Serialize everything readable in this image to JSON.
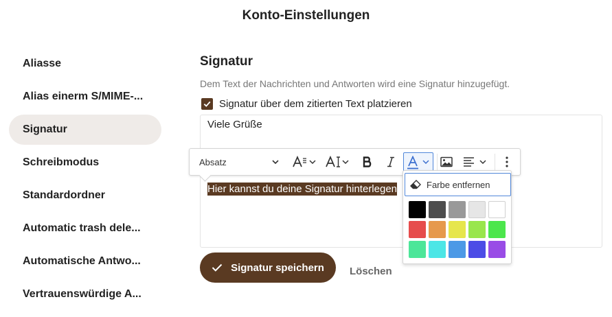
{
  "modal": {
    "title": "Konto-Einstellungen"
  },
  "sidebar": {
    "items": [
      {
        "label": "Aliasse",
        "active": false
      },
      {
        "label": "Alias einerm S/MIME-...",
        "active": false
      },
      {
        "label": "Signatur",
        "active": true
      },
      {
        "label": "Schreibmodus",
        "active": false
      },
      {
        "label": "Standardordner",
        "active": false
      },
      {
        "label": "Automatic trash dele...",
        "active": false
      },
      {
        "label": "Automatische Antwo...",
        "active": false
      },
      {
        "label": "Vertrauenswürdige A...",
        "active": false
      }
    ]
  },
  "signature": {
    "title": "Signatur",
    "description": "Dem Text der Nachrichten und Antworten wird eine Signatur hinzugefügt.",
    "above_quote_label": "Signatur über dem zitierten Text platzieren",
    "above_quote_checked": true,
    "editor_line1": "Viele Grüße",
    "editor_selected_text": "Hier kannst du deine Signatur hinterlegen"
  },
  "toolbar": {
    "heading_value": "Absatz",
    "icons": [
      "font-size-icon",
      "font-family-icon",
      "bold-icon",
      "italic-icon",
      "font-color-icon",
      "image-icon",
      "align-left-icon",
      "more-icon"
    ]
  },
  "color_panel": {
    "remove_label": "Farbe entfernen",
    "colors": [
      "#000000",
      "#4d4d4d",
      "#999999",
      "#e6e6e6",
      "#ffffff",
      "#e64c4c",
      "#e6994c",
      "#e6e64c",
      "#99e64c",
      "#4ce64c",
      "#4ce699",
      "#4ce6e6",
      "#4c99e6",
      "#4c4ce6",
      "#994ce6"
    ]
  },
  "actions": {
    "save_label": "Signatur speichern",
    "delete_label": "Löschen"
  },
  "colors": {
    "accent": "#5a3a22",
    "active_bg": "#efebe8",
    "focus": "#4f86d9"
  }
}
